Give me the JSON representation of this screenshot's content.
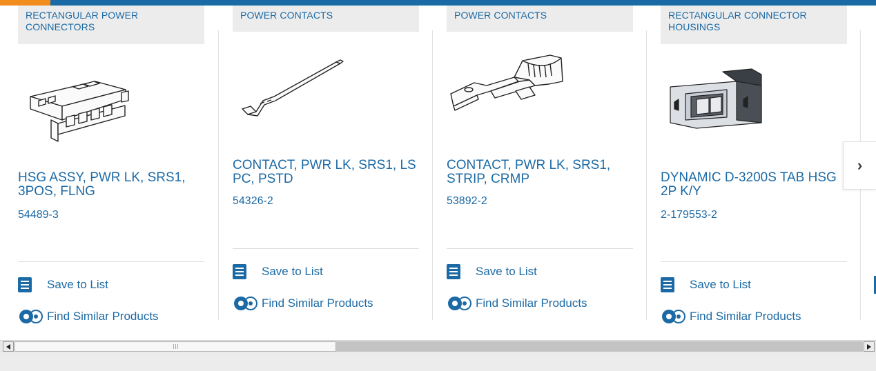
{
  "colors": {
    "accent": "#1c6aa5",
    "orange": "#f28c1f",
    "category_bg": "#ececec"
  },
  "cards": [
    {
      "category": "RECTANGULAR POWER CONNECTORS",
      "title": "HSG ASSY, PWR LK, SRS1, 3POS, FLNG",
      "part_number": "54489-3",
      "save_label": "Save to List",
      "similar_label": "Find Similar Products"
    },
    {
      "category": "POWER CONTACTS",
      "title": "CONTACT, PWR LK, SRS1, LS PC, PSTD",
      "part_number": "54326-2",
      "save_label": "Save to List",
      "similar_label": "Find Similar Products"
    },
    {
      "category": "POWER CONTACTS",
      "title": "CONTACT, PWR LK, SRS1, STRIP, CRMP",
      "part_number": "53892-2",
      "save_label": "Save to List",
      "similar_label": "Find Similar Products"
    },
    {
      "category": "RECTANGULAR CONNECTOR HOUSINGS",
      "title": "DYNAMIC D-3200S TAB HSG 2P K/Y",
      "part_number": "2-179553-2",
      "save_label": "Save to List",
      "similar_label": "Find Similar Products"
    }
  ],
  "carousel": {
    "next_icon": "chevron-right-icon",
    "next_glyph": "›"
  },
  "scrollbar": {
    "left_icon": "arrow-left-icon",
    "right_icon": "arrow-right-icon"
  }
}
